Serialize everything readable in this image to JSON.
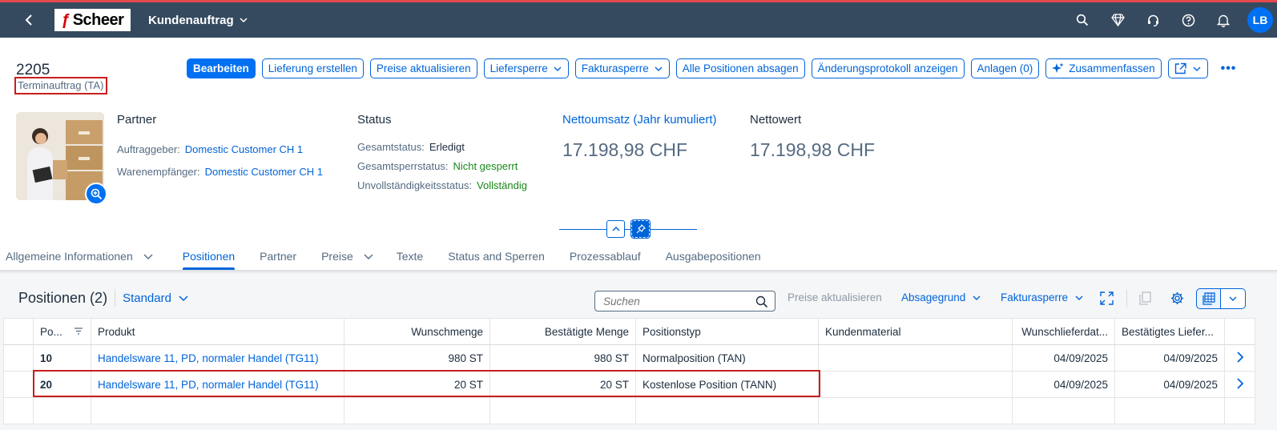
{
  "shell": {
    "logo_mark": "ƒ",
    "logo_text": "Scheer",
    "app_title": "Kundenauftrag",
    "avatar_initials": "LB"
  },
  "header": {
    "object_id": "2205",
    "object_type": "Terminauftrag (TA)",
    "actions": {
      "edit": "Bearbeiten",
      "create_delivery": "Lieferung erstellen",
      "update_prices": "Preise aktualisieren",
      "delivery_block": "Liefersperre",
      "billing_block": "Fakturasperre",
      "cancel_all": "Alle Positionen absagen",
      "change_log": "Änderungsprotokoll anzeigen",
      "attachments": "Anlagen (0)",
      "summarize": "Zusammenfassen"
    },
    "partner": {
      "title": "Partner",
      "sold_to_label": "Auftraggeber:",
      "sold_to_value": "Domestic Customer CH 1",
      "ship_to_label": "Warenempfänger:",
      "ship_to_value": "Domestic Customer CH 1"
    },
    "status": {
      "title": "Status",
      "overall_label": "Gesamtstatus:",
      "overall_value": "Erledigt",
      "block_label": "Gesamtsperrstatus:",
      "block_value": "Nicht gesperrt",
      "completeness_label": "Unvollständigkeitsstatus:",
      "completeness_value": "Vollständig"
    },
    "net_sales": {
      "title": "Nettoumsatz (Jahr kumuliert)",
      "value": "17.198,98",
      "currency": "CHF"
    },
    "net_value": {
      "title": "Nettowert",
      "value": "17.198,98",
      "currency": "CHF"
    }
  },
  "tabs": [
    {
      "label": "Allgemeine Informationen"
    },
    {
      "label": "Positionen"
    },
    {
      "label": "Partner"
    },
    {
      "label": "Preise"
    },
    {
      "label": "Texte"
    },
    {
      "label": "Status and Sperren"
    },
    {
      "label": "Prozessablauf"
    },
    {
      "label": "Ausgabepositionen"
    }
  ],
  "positions": {
    "title": "Positionen (2)",
    "variant": "Standard",
    "search_placeholder": "Suchen",
    "update_prices": "Preise aktualisieren",
    "rejection_reason": "Absagegrund",
    "billing_block": "Fakturasperre",
    "columns": [
      "Po...",
      "Produkt",
      "Wunschmenge",
      "Bestätigte Menge",
      "Positionstyp",
      "Kundenmaterial",
      "Wunschlieferdat...",
      "Bestätigtes Liefer..."
    ],
    "rows": [
      {
        "pos": "10",
        "product": "Handelsware 11, PD, normaler Handel (TG11)",
        "req_qty": "980 ST",
        "conf_qty": "980 ST",
        "item_cat": "Normalposition (TAN)",
        "cust_mat": "",
        "req_date": "04/09/2025",
        "conf_date": "04/09/2025"
      },
      {
        "pos": "20",
        "product": "Handelsware 11, PD, normaler Handel (TG11)",
        "req_qty": "20 ST",
        "conf_qty": "20 ST",
        "item_cat": "Kostenlose Position (TANN)",
        "cust_mat": "",
        "req_date": "04/09/2025",
        "conf_date": "04/09/2025"
      }
    ]
  },
  "colors": {
    "shell": "#354a5f",
    "accent": "#0070f2",
    "link": "#0064d9",
    "positive": "#188918",
    "highlight": "#c81e1e"
  }
}
